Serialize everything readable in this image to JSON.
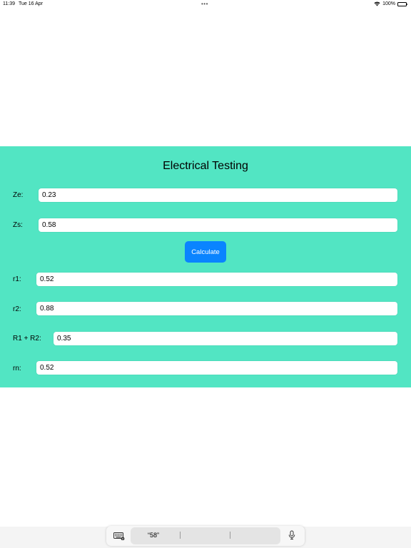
{
  "status_bar": {
    "time": "11:39",
    "date": "Tue 16 Apr",
    "dots": "•••",
    "battery": "100%",
    "icons": [
      "wifi-icon",
      "battery-icon"
    ]
  },
  "app": {
    "title": "Electrical Testing",
    "panel_color": "#52e5c3",
    "accent_color": "#0a84ff"
  },
  "fields": {
    "ze": {
      "label": "Ze:",
      "value": "0.23"
    },
    "zs": {
      "label": "Zs:",
      "value": "0.58"
    },
    "r1": {
      "label": "r1:",
      "value": "0.52"
    },
    "r2": {
      "label": "r2:",
      "value": "0.88"
    },
    "r1r2": {
      "label": "R1 + R2:",
      "value": "0.35"
    },
    "rn": {
      "label": "rn:",
      "value": "0.52"
    }
  },
  "actions": {
    "calculate": "Calculate"
  },
  "keyboard_bar": {
    "suggestions": [
      "“58”",
      "",
      ""
    ],
    "icons": [
      "keyboard-icon",
      "microphone-icon"
    ]
  }
}
